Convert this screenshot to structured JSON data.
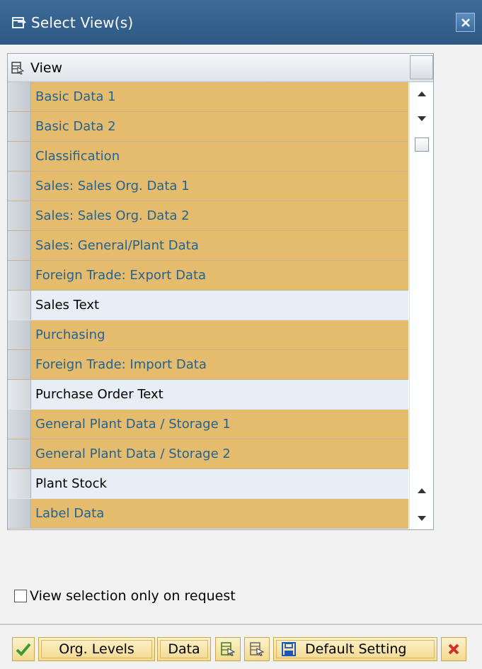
{
  "window": {
    "title": "Select View(s)",
    "icon": "select-view-icon",
    "close_icon": "close-icon"
  },
  "table": {
    "header_icon": "column-select-icon",
    "column_label": "View",
    "rows": [
      {
        "label": "Basic Data 1",
        "selected": true
      },
      {
        "label": "Basic Data 2",
        "selected": true
      },
      {
        "label": "Classification",
        "selected": true
      },
      {
        "label": "Sales: Sales Org. Data 1",
        "selected": true
      },
      {
        "label": "Sales: Sales Org. Data 2",
        "selected": true
      },
      {
        "label": "Sales: General/Plant Data",
        "selected": true
      },
      {
        "label": "Foreign Trade: Export Data",
        "selected": true
      },
      {
        "label": "Sales Text",
        "selected": false
      },
      {
        "label": "Purchasing",
        "selected": true
      },
      {
        "label": "Foreign Trade: Import Data",
        "selected": true
      },
      {
        "label": "Purchase Order Text",
        "selected": false
      },
      {
        "label": "General Plant Data / Storage 1",
        "selected": true
      },
      {
        "label": "General Plant Data / Storage 2",
        "selected": true
      },
      {
        "label": "Plant Stock",
        "selected": false
      },
      {
        "label": "Label Data",
        "selected": true
      }
    ]
  },
  "checkbox": {
    "label": "View selection only on request",
    "checked": false
  },
  "toolbar": {
    "confirm_icon": "checkmark-icon",
    "org_levels_label": "Org. Levels",
    "data_label": "Data",
    "select_all_icon": "select-all-icon",
    "deselect_all_icon": "deselect-all-icon",
    "save_icon": "save-icon",
    "default_setting_label": "Default Setting",
    "cancel_icon": "cancel-icon"
  },
  "colors": {
    "selected_row": "#e5bb6e",
    "selected_text": "#24638f",
    "unselected_row": "#e7eef5",
    "titlebar": "#2e5985"
  }
}
